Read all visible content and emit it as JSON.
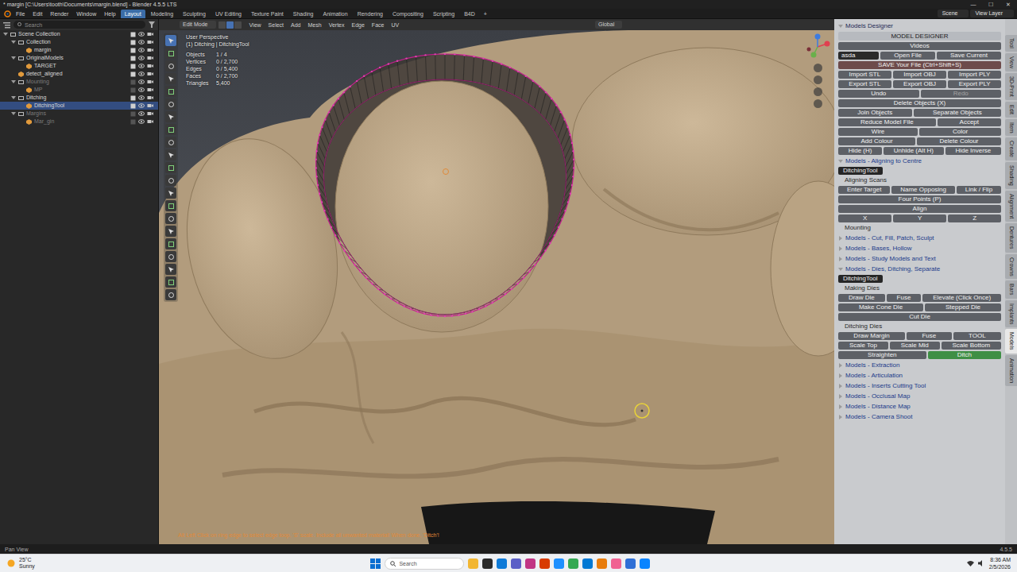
{
  "window": {
    "title": "* margin [C:\\Users\\tooth\\Documents\\margin.blend] - Blender 4.5.5 LTS",
    "controls": [
      "—",
      "☐",
      "✕"
    ]
  },
  "menus": [
    "File",
    "Edit",
    "Render",
    "Window",
    "Help"
  ],
  "workspaces": [
    {
      "label": "Layout",
      "selected": true
    },
    {
      "label": "Modeling",
      "selected": false
    },
    {
      "label": "Sculpting",
      "selected": false
    },
    {
      "label": "UV Editing",
      "selected": false
    },
    {
      "label": "Texture Paint",
      "selected": false
    },
    {
      "label": "Shading",
      "selected": false
    },
    {
      "label": "Animation",
      "selected": false
    },
    {
      "label": "Rendering",
      "selected": false
    },
    {
      "label": "Compositing",
      "selected": false
    },
    {
      "label": "Scripting",
      "selected": false
    },
    {
      "label": "B4D",
      "selected": false
    }
  ],
  "add_workspace": "+",
  "scene": "Scene",
  "view_layer": "View Layer",
  "outliner": {
    "search": "Search",
    "tree": [
      {
        "label": "Scene Collection",
        "expanded": true,
        "selected": false,
        "disabled": false,
        "children": [
          {
            "label": "Collection",
            "expanded": true,
            "selected": false,
            "disabled": false,
            "children": [
              {
                "label": "margin",
                "expanded": false,
                "selected": false,
                "disabled": false
              }
            ]
          },
          {
            "label": "OriginalModels",
            "expanded": true,
            "selected": false,
            "disabled": false,
            "children": [
              {
                "label": "TARGET",
                "expanded": false,
                "selected": false,
                "disabled": false
              }
            ]
          },
          {
            "label": "detect_aligned",
            "expanded": false,
            "selected": false,
            "disabled": false
          },
          {
            "label": "Mounting",
            "expanded": true,
            "selected": false,
            "disabled": true,
            "children": [
              {
                "label": "MP",
                "expanded": false,
                "selected": false,
                "disabled": true
              }
            ]
          },
          {
            "label": "Ditching",
            "expanded": true,
            "selected": false,
            "disabled": false,
            "children": [
              {
                "label": "DitchingTool",
                "expanded": false,
                "selected": true,
                "disabled": false
              }
            ]
          },
          {
            "label": "Margins",
            "expanded": true,
            "selected": false,
            "disabled": true,
            "children": [
              {
                "label": "Mar_gin",
                "expanded": false,
                "selected": false,
                "disabled": true
              }
            ]
          }
        ]
      }
    ]
  },
  "viewport": {
    "mode": "Edit Mode",
    "menus": [
      "View",
      "Select",
      "Add",
      "Mesh",
      "Vertex",
      "Edge",
      "Face",
      "UV"
    ],
    "orientation": "Global",
    "overlay": {
      "title": "User Perspective",
      "context": "(1) Ditching | DitchingTool",
      "stats": [
        {
          "label": "Objects",
          "value": "1 / 4"
        },
        {
          "label": "Vertices",
          "value": "0 / 2,700"
        },
        {
          "label": "Edges",
          "value": "0 / 5,400"
        },
        {
          "label": "Faces",
          "value": "0 / 2,700"
        },
        {
          "label": "Triangles",
          "value": "5,400"
        }
      ]
    },
    "hint": "Alt Left Click on ring edge to select edge loop, 'S' scale. Include all unwanted material! When done, 'Ditch'!"
  },
  "sidebar": {
    "blocks": [
      {
        "kind": "header",
        "label": "Models Designer"
      },
      {
        "kind": "title",
        "label": "MODEL DESIGNER"
      },
      {
        "kind": "row",
        "buttons": [
          {
            "label": "Videos",
            "kind": "button",
            "selected": false,
            "disabled": false
          }
        ]
      },
      {
        "kind": "row",
        "buttons": [
          {
            "label": "asda",
            "kind": "field",
            "selected": false,
            "disabled": false
          },
          {
            "label": "Open File",
            "kind": "button",
            "selected": false,
            "disabled": false
          },
          {
            "label": "Save Current",
            "kind": "button",
            "selected": false,
            "disabled": false
          }
        ]
      },
      {
        "kind": "row",
        "buttons": [
          {
            "label": "SAVE Your File (Ctrl+Shift+S)",
            "kind": "accent",
            "selected": false,
            "disabled": false
          }
        ]
      },
      {
        "kind": "row",
        "buttons": [
          {
            "label": "Import STL",
            "kind": "button",
            "selected": false,
            "disabled": false
          },
          {
            "label": "Import OBJ",
            "kind": "button",
            "selected": false,
            "disabled": false
          },
          {
            "label": "Import PLY",
            "kind": "button",
            "selected": false,
            "disabled": false
          }
        ]
      },
      {
        "kind": "row",
        "buttons": [
          {
            "label": "Export STL",
            "kind": "button",
            "selected": false,
            "disabled": false
          },
          {
            "label": "Export OBJ",
            "kind": "button",
            "selected": false,
            "disabled": false
          },
          {
            "label": "Export PLY",
            "kind": "button",
            "selected": false,
            "disabled": false
          }
        ]
      },
      {
        "kind": "row",
        "buttons": [
          {
            "label": "Undo",
            "kind": "button",
            "selected": false,
            "disabled": false
          },
          {
            "label": "Redo",
            "kind": "button",
            "selected": false,
            "disabled": true
          }
        ]
      },
      {
        "kind": "row",
        "buttons": [
          {
            "label": "Delete Objects (X)",
            "kind": "button",
            "selected": false,
            "disabled": false
          }
        ]
      },
      {
        "kind": "row",
        "buttons": [
          {
            "label": "Join Objects",
            "kind": "button",
            "selected": false,
            "disabled": false
          },
          {
            "label": "Separate Objects",
            "kind": "button",
            "selected": false,
            "disabled": false
          }
        ]
      },
      {
        "kind": "row",
        "buttons": [
          {
            "label": "Reduce Model File",
            "kind": "button",
            "selected": false,
            "disabled": false
          },
          {
            "label": "Accept",
            "kind": "button",
            "selected": false,
            "disabled": false
          }
        ]
      },
      {
        "kind": "row",
        "buttons": [
          {
            "label": "Wire",
            "kind": "button",
            "selected": false,
            "disabled": false
          },
          {
            "label": "Color",
            "kind": "button",
            "selected": false,
            "disabled": false
          }
        ]
      },
      {
        "kind": "row",
        "buttons": [
          {
            "label": "Add Colour",
            "kind": "button",
            "selected": false,
            "disabled": false
          },
          {
            "label": "Delete Colour",
            "kind": "button",
            "selected": false,
            "disabled": false
          }
        ]
      },
      {
        "kind": "row",
        "buttons": [
          {
            "label": "Hide (H)",
            "kind": "button",
            "selected": false,
            "disabled": false
          },
          {
            "label": "Unhide (Alt H)",
            "kind": "button",
            "selected": false,
            "disabled": false
          },
          {
            "label": "Hide Inverse",
            "kind": "button",
            "selected": false,
            "disabled": false
          }
        ]
      },
      {
        "kind": "section",
        "label": "Models - Aligning to Centre",
        "expanded": true
      },
      {
        "kind": "label",
        "label": "DitchingTool"
      },
      {
        "kind": "subheader",
        "label": "Aligning Scans"
      },
      {
        "kind": "row",
        "buttons": [
          {
            "label": "Enter Target",
            "kind": "button",
            "selected": false,
            "disabled": false
          },
          {
            "label": "Name Opposing",
            "kind": "button",
            "selected": false,
            "disabled": false
          },
          {
            "label": "Link / Flip",
            "kind": "button",
            "selected": false,
            "disabled": false
          }
        ]
      },
      {
        "kind": "row",
        "buttons": [
          {
            "label": "Four Points (P)",
            "kind": "button",
            "selected": false,
            "disabled": false
          }
        ]
      },
      {
        "kind": "row",
        "buttons": [
          {
            "label": "Align",
            "kind": "button",
            "selected": false,
            "disabled": false
          }
        ]
      },
      {
        "kind": "row",
        "buttons": [
          {
            "label": "X",
            "kind": "button",
            "selected": false,
            "disabled": false
          },
          {
            "label": "Y",
            "kind": "button",
            "selected": false,
            "disabled": false
          },
          {
            "label": "Z",
            "kind": "button",
            "selected": false,
            "disabled": false
          }
        ]
      },
      {
        "kind": "subheader",
        "label": "Mounting"
      },
      {
        "kind": "section",
        "label": "Models - Cut, Fill, Patch, Sculpt",
        "expanded": false
      },
      {
        "kind": "section",
        "label": "Models - Bases, Hollow",
        "expanded": false
      },
      {
        "kind": "section",
        "label": "Models - Study Models and Text",
        "expanded": false
      },
      {
        "kind": "section",
        "label": "Models - Dies, Ditching, Separate",
        "expanded": true
      },
      {
        "kind": "label",
        "label": "DitchingTool"
      },
      {
        "kind": "subheader",
        "label": "Making Dies"
      },
      {
        "kind": "row",
        "buttons": [
          {
            "label": "Draw Die",
            "kind": "button",
            "selected": false,
            "disabled": false
          },
          {
            "label": "Fuse",
            "kind": "button",
            "selected": false,
            "disabled": false
          },
          {
            "label": "Elevate (Click Once)",
            "kind": "button",
            "selected": false,
            "disabled": false
          }
        ]
      },
      {
        "kind": "row",
        "buttons": [
          {
            "label": "Make Cone Die",
            "kind": "button",
            "selected": false,
            "disabled": false
          },
          {
            "label": "Stepped Die",
            "kind": "button",
            "selected": false,
            "disabled": false
          }
        ]
      },
      {
        "kind": "row",
        "buttons": [
          {
            "label": "Cut Die",
            "kind": "button",
            "selected": false,
            "disabled": false
          }
        ]
      },
      {
        "kind": "subheader",
        "label": "Ditching Dies"
      },
      {
        "kind": "row",
        "buttons": [
          {
            "label": "Draw Margin",
            "kind": "button",
            "selected": false,
            "disabled": false
          },
          {
            "label": "Fuse",
            "kind": "button",
            "selected": false,
            "disabled": false
          },
          {
            "label": "TOOL",
            "kind": "button",
            "selected": false,
            "disabled": false
          }
        ]
      },
      {
        "kind": "row",
        "buttons": [
          {
            "label": "Scale Top",
            "kind": "button",
            "selected": false,
            "disabled": false
          },
          {
            "label": "Scale Mid",
            "kind": "button",
            "selected": false,
            "disabled": false
          },
          {
            "label": "Scale Bottom",
            "kind": "button",
            "selected": false,
            "disabled": false
          }
        ]
      },
      {
        "kind": "row",
        "buttons": [
          {
            "label": "Straighten",
            "kind": "button",
            "selected": false,
            "disabled": false
          },
          {
            "label": "Ditch",
            "kind": "button",
            "selected": true,
            "disabled": false
          }
        ]
      },
      {
        "kind": "section",
        "label": "Models - Extraction",
        "expanded": false
      },
      {
        "kind": "section",
        "label": "Models - Articulation",
        "expanded": false
      },
      {
        "kind": "section",
        "label": "Models - Inserts Cutting Tool",
        "expanded": false
      },
      {
        "kind": "section",
        "label": "Models - Occlusal Map",
        "expanded": false
      },
      {
        "kind": "section",
        "label": "Models - Distance Map",
        "expanded": false
      },
      {
        "kind": "section",
        "label": "Models - Camera Shoot",
        "expanded": false
      }
    ]
  },
  "tabs": [
    {
      "label": "Tool",
      "selected": false
    },
    {
      "label": "View",
      "selected": false
    },
    {
      "label": "3D-Print",
      "selected": false
    },
    {
      "label": "Edit",
      "selected": false
    },
    {
      "label": "Item",
      "selected": false
    },
    {
      "label": "Create",
      "selected": false
    },
    {
      "label": "Shading",
      "selected": false
    },
    {
      "label": "Alignment",
      "selected": false
    },
    {
      "label": "Dentures",
      "selected": false
    },
    {
      "label": "Crowns",
      "selected": false
    },
    {
      "label": "Bars",
      "selected": false
    },
    {
      "label": "Implants",
      "selected": false
    },
    {
      "label": "Models",
      "selected": true
    },
    {
      "label": "Animation",
      "selected": false
    }
  ],
  "status": {
    "left": "Pan View",
    "version": "4.5.5"
  },
  "taskbar": {
    "temperature": "25°C",
    "weather": "Sunny",
    "search": "Search",
    "apps": [
      {
        "color": "#f2b632"
      },
      {
        "color": "#2b2b2b"
      },
      {
        "color": "#0f7bd8"
      },
      {
        "color": "#5b5fc7"
      },
      {
        "color": "#c13584"
      },
      {
        "color": "#d83b01"
      },
      {
        "color": "#1e90ff"
      },
      {
        "color": "#34a853"
      },
      {
        "color": "#0078d4"
      },
      {
        "color": "#e87d0d"
      },
      {
        "color": "#f06292"
      },
      {
        "color": "#2f6fd6"
      },
      {
        "color": "#0a84ff"
      }
    ],
    "time": "8:36 AM",
    "date": "2/5/2026"
  }
}
